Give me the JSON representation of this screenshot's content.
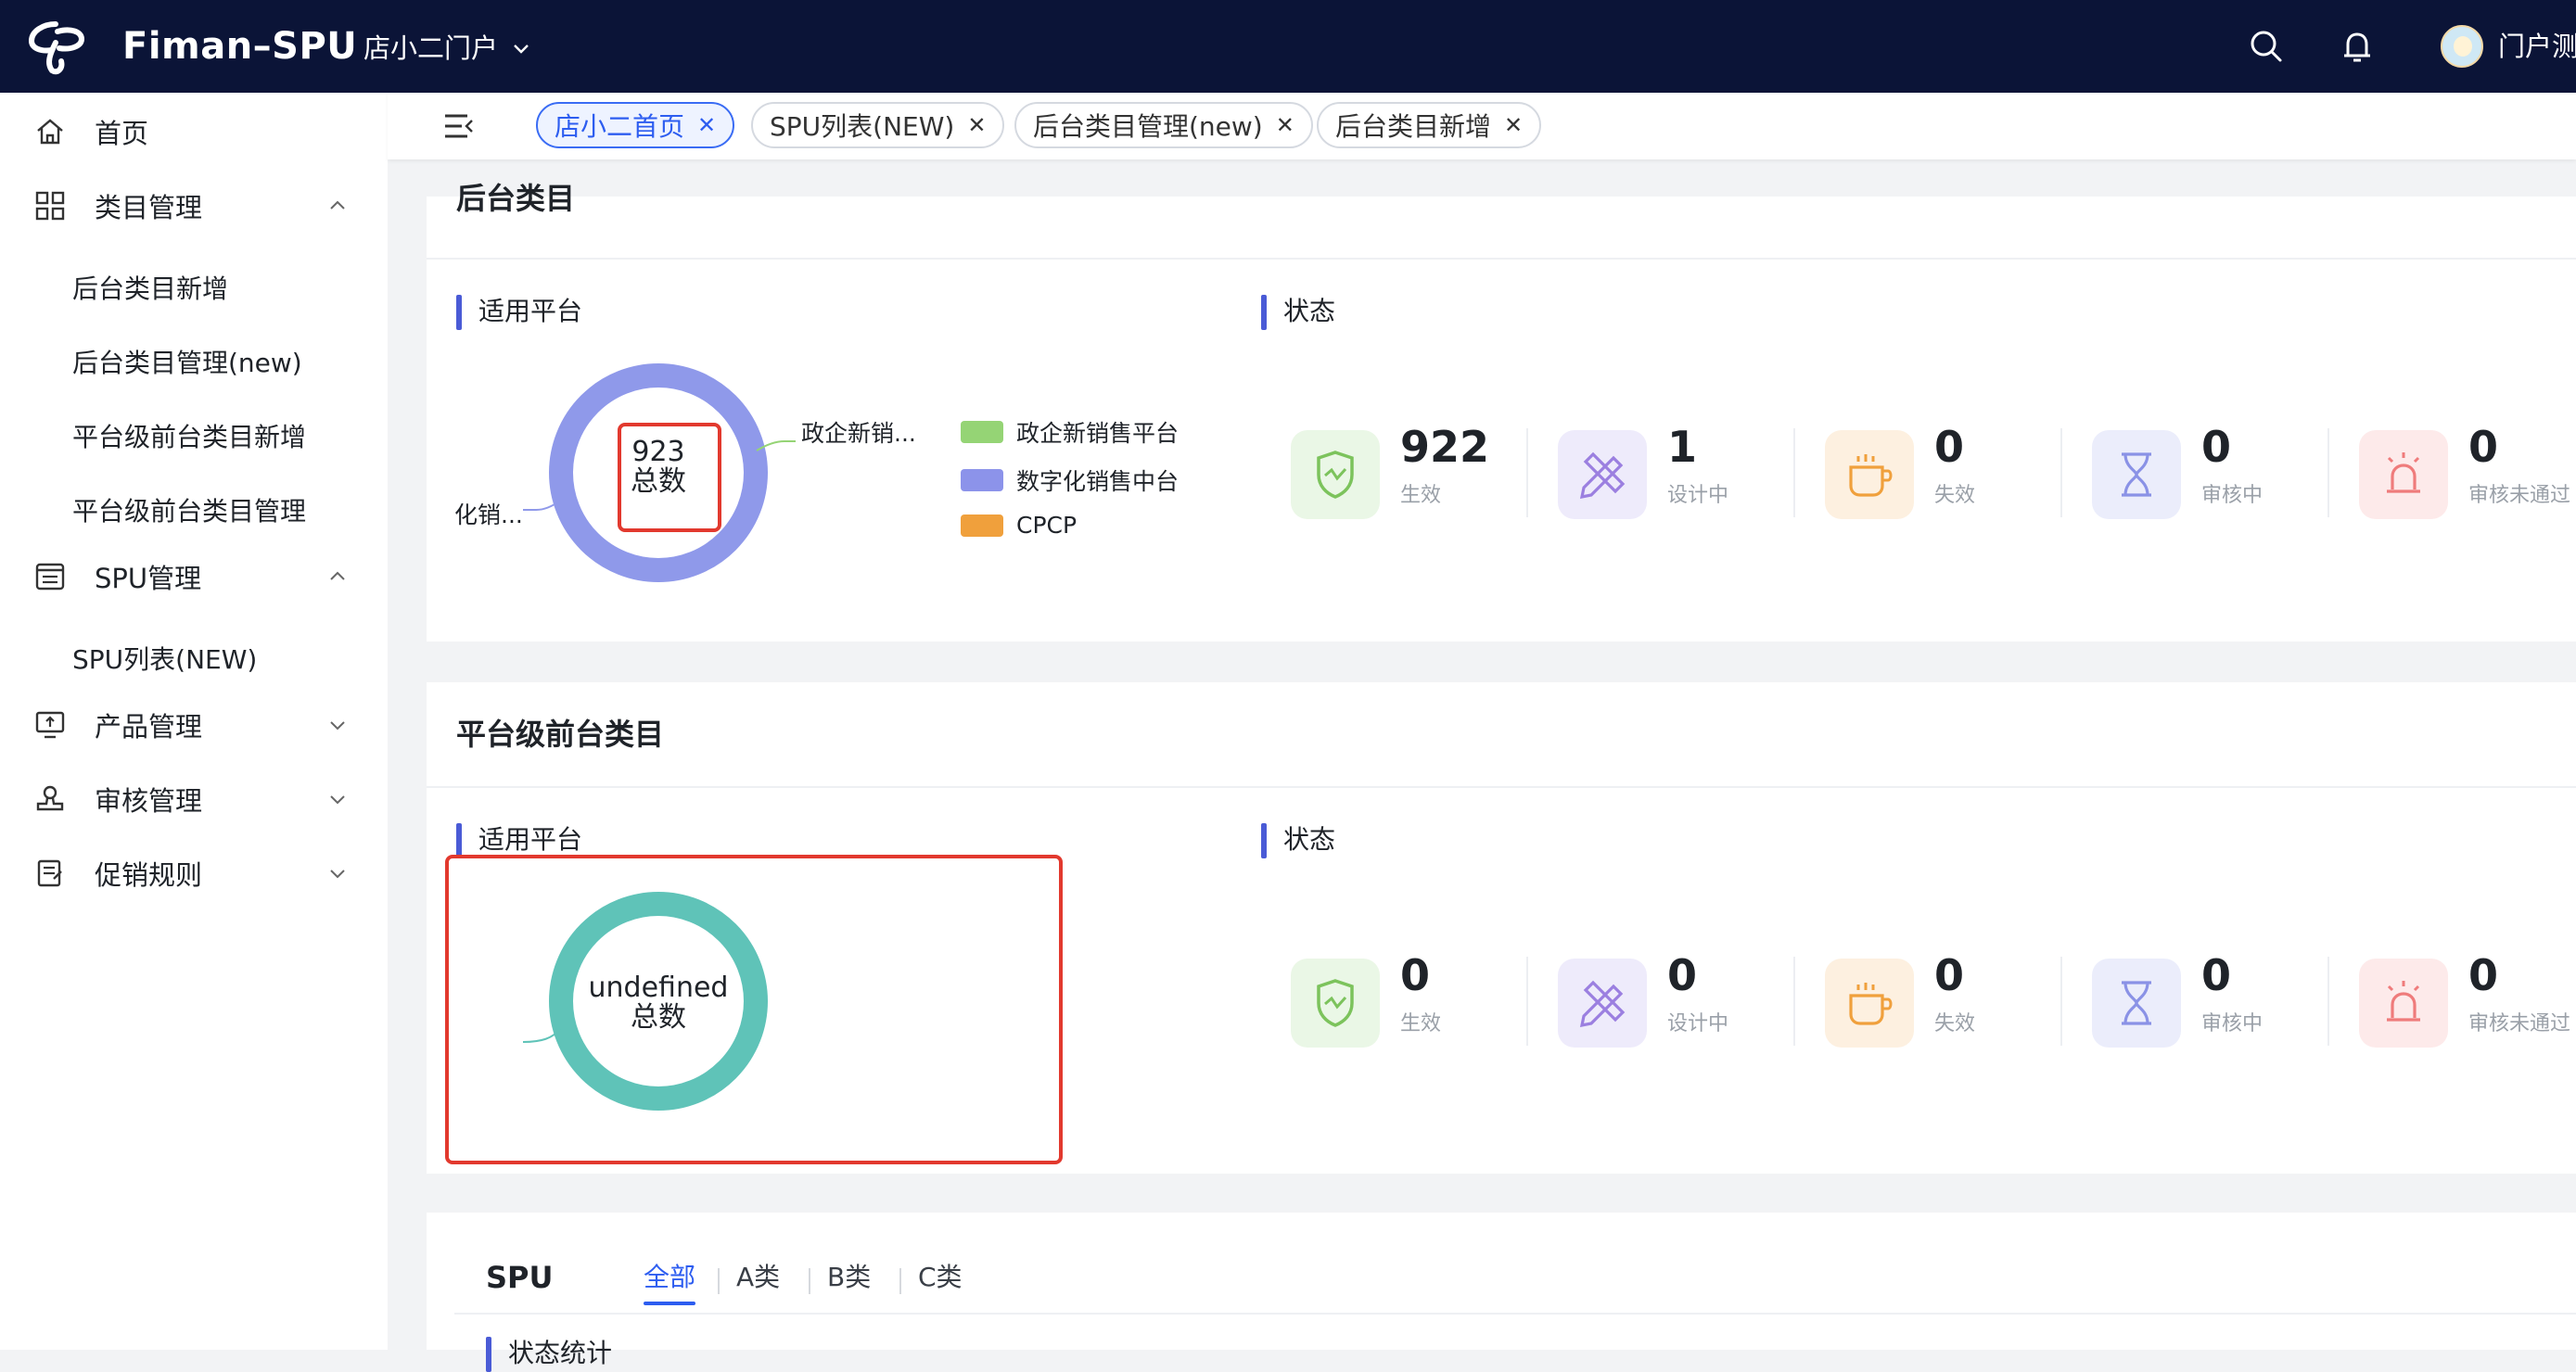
{
  "topbar": {
    "app_title": "Fiman–SPU",
    "portal_label": "店小二门户",
    "user_name": "门户测",
    "brand_color": "#0b1437",
    "icons": [
      "telecom-logo-icon",
      "chevron-down-icon",
      "search-icon",
      "bell-icon"
    ]
  },
  "sidebar": {
    "items": [
      {
        "label": "首页",
        "icon": "home-icon"
      },
      {
        "label": "类目管理",
        "icon": "grid-icon",
        "expanded": true,
        "children": [
          "后台类目新增",
          "后台类目管理(new)",
          "平台级前台类目新增",
          "平台级前台类目管理"
        ]
      },
      {
        "label": "SPU管理",
        "icon": "list-icon",
        "expanded": true,
        "children": [
          "SPU列表(NEW)"
        ]
      },
      {
        "label": "产品管理",
        "icon": "monitor-icon",
        "expanded": false
      },
      {
        "label": "审核管理",
        "icon": "stamp-icon",
        "expanded": false
      },
      {
        "label": "促销规则",
        "icon": "document-icon",
        "expanded": false
      }
    ]
  },
  "tabs": [
    {
      "label": "店小二首页",
      "active": true
    },
    {
      "label": "SPU列表(NEW)",
      "active": false
    },
    {
      "label": "后台类目管理(new)",
      "active": false
    },
    {
      "label": "后台类目新增",
      "active": false
    }
  ],
  "backend_card": {
    "title": "后台类目",
    "platform_section": "适用平台",
    "status_section": "状态",
    "donut": {
      "total": "923",
      "total_label": "总数",
      "callout_right": "政企新销...",
      "callout_left": "化销..."
    },
    "legend": [
      {
        "label": "政企新销售平台",
        "color": "#95d475"
      },
      {
        "label": "数字化销售中台",
        "color": "#8c93ea"
      },
      {
        "label": "CPCP",
        "color": "#f0a03c"
      }
    ],
    "stats": [
      {
        "value": "922",
        "label": "生效",
        "color": "#eaf7e6",
        "icon": "shield-icon"
      },
      {
        "value": "1",
        "label": "设计中",
        "color": "#eeebfb",
        "icon": "pencil-ruler-icon"
      },
      {
        "value": "0",
        "label": "失效",
        "color": "#fdf0e0",
        "icon": "cup-icon"
      },
      {
        "value": "0",
        "label": "审核中",
        "color": "#ebedfb",
        "icon": "hourglass-icon"
      },
      {
        "value": "0",
        "label": "审核未通过",
        "color": "#fdeaea",
        "icon": "alarm-icon"
      }
    ]
  },
  "frontend_card": {
    "title": "平台级前台类目",
    "platform_section": "适用平台",
    "status_section": "状态",
    "donut": {
      "total": "undefined",
      "total_label": "总数"
    },
    "stats": [
      {
        "value": "0",
        "label": "生效"
      },
      {
        "value": "0",
        "label": "设计中"
      },
      {
        "value": "0",
        "label": "失效"
      },
      {
        "value": "0",
        "label": "审核中"
      },
      {
        "value": "0",
        "label": "审核未通过"
      }
    ]
  },
  "spu_card": {
    "title": "SPU",
    "filters": [
      "全部",
      "A类",
      "B类",
      "C类"
    ],
    "active_filter": "全部",
    "section": "状态统计"
  }
}
